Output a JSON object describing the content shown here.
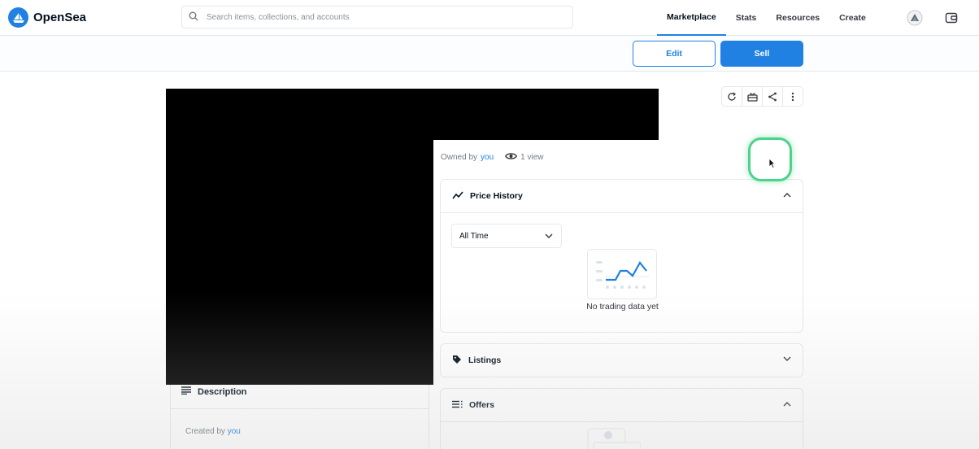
{
  "header": {
    "logo_text": "OpenSea",
    "search_placeholder": "Search items, collections, and accounts",
    "nav": [
      "Marketplace",
      "Stats",
      "Resources",
      "Create"
    ],
    "active_nav": "Marketplace"
  },
  "actions": {
    "edit_label": "Edit",
    "sell_label": "Sell"
  },
  "item": {
    "owned_by_prefix": "Owned by",
    "owner": "you",
    "views": "1 view",
    "created_by_prefix": "Created by",
    "creator": "you"
  },
  "description": {
    "title": "Description"
  },
  "price_history": {
    "title": "Price History",
    "range_selected": "All Time",
    "empty_text": "No trading data yet"
  },
  "listings": {
    "title": "Listings"
  },
  "offers": {
    "title": "Offers"
  },
  "colors": {
    "accent": "#2081e2",
    "focus_ring": "#4cd38a",
    "redacted": "#000000"
  }
}
